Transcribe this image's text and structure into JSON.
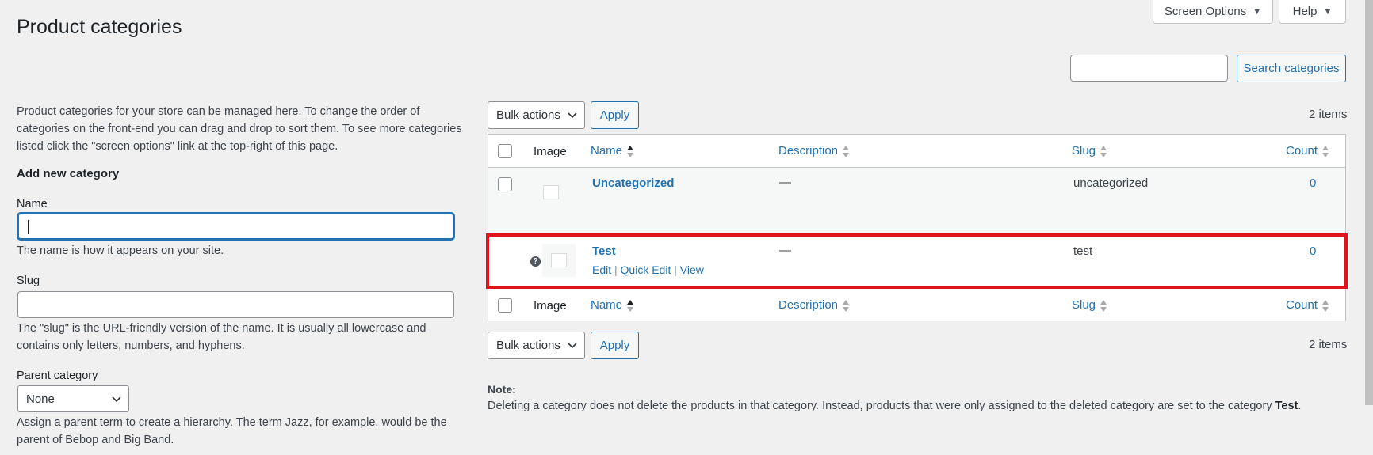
{
  "page": {
    "title": "Product categories",
    "screen_options_label": "Screen Options",
    "help_label": "Help"
  },
  "search": {
    "value": "",
    "button_label": "Search categories"
  },
  "bulk": {
    "label": "Bulk actions",
    "apply_label": "Apply",
    "items_count": "2 items"
  },
  "form": {
    "intro": "Product categories for your store can be managed here. To change the order of categories on the front-end you can drag and drop to sort them. To see more categories listed click the \"screen options\" link at the top-right of this page.",
    "heading": "Add new category",
    "name_label": "Name",
    "name_value": "",
    "name_help": "The name is how it appears on your site.",
    "slug_label": "Slug",
    "slug_value": "",
    "slug_help": "The \"slug\" is the URL-friendly version of the name. It is usually all lowercase and contains only letters, numbers, and hyphens.",
    "parent_label": "Parent category",
    "parent_value": "None",
    "parent_help": "Assign a parent term to create a hierarchy. The term Jazz, for example, would be the parent of Bebop and Big Band."
  },
  "table": {
    "columns": {
      "image": "Image",
      "name": "Name",
      "description": "Description",
      "slug": "Slug",
      "count": "Count"
    },
    "rows": [
      {
        "name": "Uncategorized",
        "description": "—",
        "slug": "uncategorized",
        "count": "0"
      },
      {
        "name": "Test",
        "description": "—",
        "slug": "test",
        "count": "0",
        "actions": {
          "edit": "Edit",
          "quick_edit": "Quick Edit",
          "view": "View"
        },
        "help_icon": "?"
      }
    ]
  },
  "note": {
    "heading": "Note:",
    "text": "Deleting a category does not delete the products in that category. Instead, products that were only assigned to the deleted category are set to the category ",
    "category": "Test",
    "end": "."
  },
  "colors": {
    "accent": "#2271b1",
    "highlight": "#e0131a"
  }
}
